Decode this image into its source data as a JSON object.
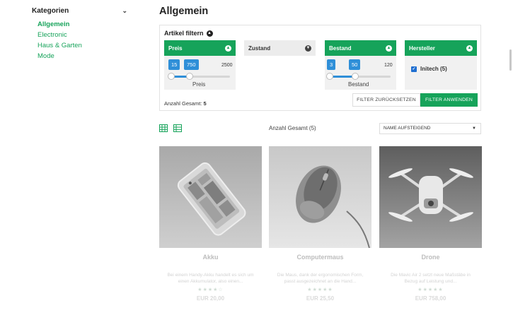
{
  "sidebar": {
    "title": "Kategorien",
    "items": [
      {
        "label": "Allgemein"
      },
      {
        "label": "Electronic"
      },
      {
        "label": "Haus & Garten"
      },
      {
        "label": "Mode"
      }
    ]
  },
  "page": {
    "title": "Allgemein"
  },
  "filter": {
    "title": "Artikel filtern",
    "preis": {
      "label": "Preis",
      "min": "15",
      "max": "750",
      "range_max": "2500",
      "slider_label": "Preis"
    },
    "zustand": {
      "label": "Zustand"
    },
    "bestand": {
      "label": "Bestand",
      "min": "3",
      "max": "50",
      "range_max": "120",
      "slider_label": "Bestand"
    },
    "hersteller": {
      "label": "Hersteller",
      "option": "Initech (5)"
    },
    "total_label": "Anzahl Gesamt:",
    "total_value": "5",
    "reset_label": "FILTER ZURÜCKSETZEN",
    "apply_label": "FILTER ANWENDEN"
  },
  "listing": {
    "total": "Anzahl Gesamt (5)",
    "sort": "NAME AUFSTEIGEND"
  },
  "products": [
    {
      "name": "Akku",
      "desc": "Bei einem Handy-Akku handelt es sich um einen Akkumulator, also einen...",
      "stars": "★★★★☆",
      "price": "EUR 20,00"
    },
    {
      "name": "Computermaus",
      "desc": "Die Maus, dank der ergonomischen Form, passt ausgezeichnet an die Hand...",
      "stars": "★★★★★",
      "price": "EUR 25,50"
    },
    {
      "name": "Drone",
      "desc": "Die Mavic Air 2 setzt neue Maßstäbe in Bezug auf Leistung und...",
      "stars": "★★★★★",
      "price": "EUR 758,00"
    }
  ],
  "colors": {
    "accent": "#16a35a",
    "slider": "#2f8fd8"
  }
}
